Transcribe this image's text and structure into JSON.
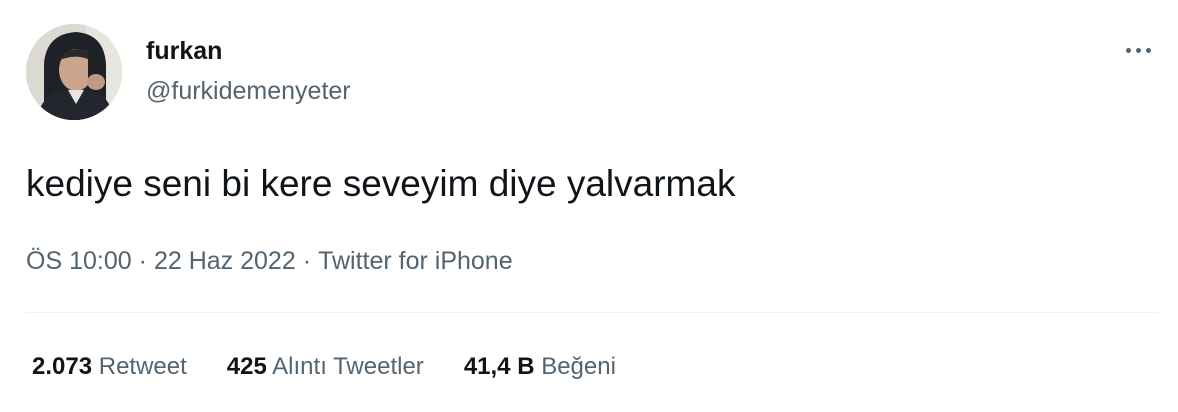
{
  "author": {
    "display_name": "furkan",
    "handle": "@furkidemenyeter"
  },
  "more_icon": "more-horizontal-icon",
  "tweet": {
    "text": "kediye seni bi kere seveyim diye yalvarmak",
    "time": "ÖS 10:00",
    "date": "22 Haz 2022",
    "source": "Twitter for iPhone",
    "separator": "·"
  },
  "stats": {
    "retweets": {
      "count": "2.073",
      "label": "Retweet"
    },
    "quotes": {
      "count": "425",
      "label": "Alıntı Tweetler"
    },
    "likes": {
      "count": "41,4 B",
      "label": "Beğeni"
    }
  },
  "colors": {
    "text_primary": "#0f1419",
    "text_secondary": "#536471",
    "divider": "#eff3f4"
  }
}
